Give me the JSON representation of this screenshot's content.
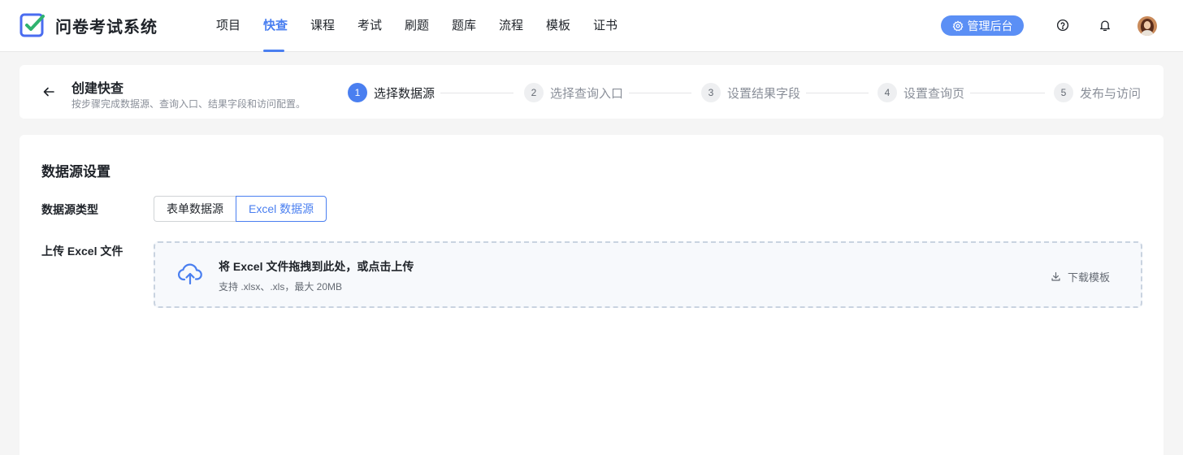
{
  "app": {
    "name": "问卷考试系统",
    "accent": "#4a7ff0"
  },
  "nav": {
    "items": [
      "项目",
      "快查",
      "课程",
      "考试",
      "刷题",
      "题库",
      "流程",
      "模板",
      "证书"
    ],
    "active": "快查"
  },
  "header": {
    "admin_label": "管理后台",
    "icons": [
      "help-icon",
      "bell-icon",
      "avatar"
    ]
  },
  "page": {
    "title": "创建快查",
    "subtitle": "按步骤完成数据源、查询入口、结果字段和访问配置。"
  },
  "steps": [
    {
      "num": "1",
      "label": "选择数据源",
      "active": true
    },
    {
      "num": "2",
      "label": "选择查询入口",
      "active": false
    },
    {
      "num": "3",
      "label": "设置结果字段",
      "active": false
    },
    {
      "num": "4",
      "label": "设置查询页",
      "active": false
    },
    {
      "num": "5",
      "label": "发布与访问",
      "active": false
    }
  ],
  "form": {
    "section_title": "数据源设置",
    "type_label": "数据源类型",
    "type_options": [
      "表单数据源",
      "Excel 数据源"
    ],
    "type_selected": "Excel 数据源",
    "upload_label": "上传 Excel 文件",
    "upload_title": "将 Excel 文件拖拽到此处，或点击上传",
    "upload_hint": "支持 .xlsx、.xls，最大 20MB",
    "download_label": "下载模板"
  }
}
